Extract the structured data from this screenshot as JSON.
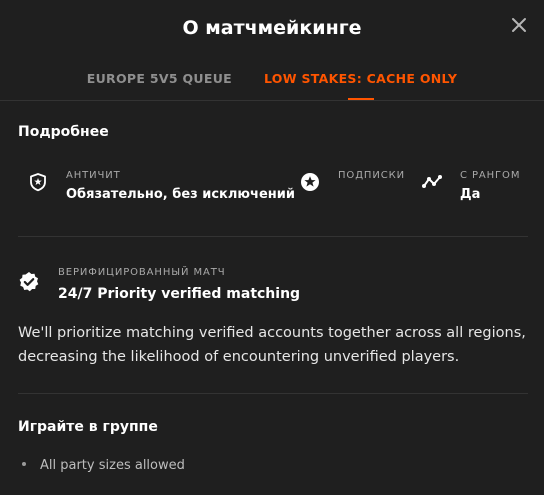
{
  "modal": {
    "title": "О матчмейкинге",
    "close_icon": "close-icon"
  },
  "tabs": [
    {
      "label": "EUROPE 5V5 QUEUE",
      "active": false
    },
    {
      "label": "LOW STAKES: CACHE ONLY",
      "active": true
    }
  ],
  "accent_color": "#ff5500",
  "details": {
    "title": "Подробнее",
    "items": [
      {
        "icon": "shield-icon",
        "label": "АНТИЧИТ",
        "value": "Обязательно, без исключений"
      },
      {
        "icon": "star-badge-icon",
        "label": "ПОДПИСКИ",
        "value": ""
      },
      {
        "icon": "trend-icon",
        "label": "С РАНГОМ",
        "value": "Да"
      }
    ]
  },
  "verified": {
    "icon": "verified-badge-icon",
    "label": "ВЕРИФИЦИРОВАННЫЙ МАТЧ",
    "value": "24/7 Priority verified matching",
    "description": "We'll prioritize matching verified accounts together across all regions, decreasing the likelihood of encountering unverified players."
  },
  "party": {
    "title": "Играйте в группе",
    "items": [
      "All party sizes allowed"
    ]
  }
}
